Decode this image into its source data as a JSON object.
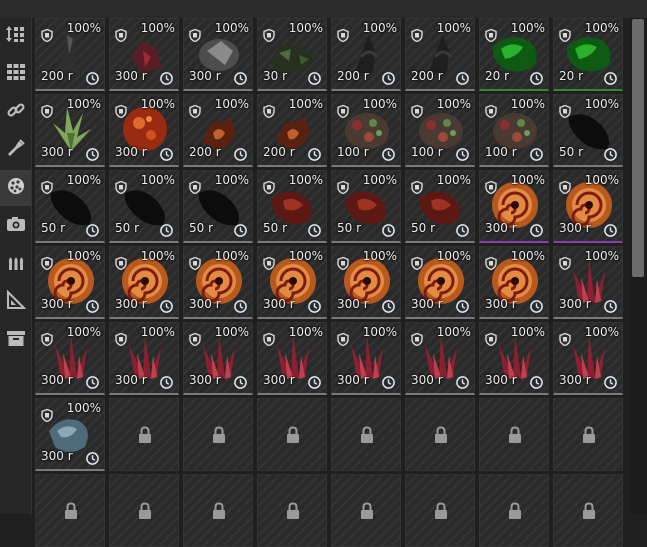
{
  "sidebar": {
    "items": [
      {
        "icon": "sort-grid-icon"
      },
      {
        "icon": "grid-icon"
      },
      {
        "icon": "link-icon"
      },
      {
        "icon": "flashlight-icon"
      },
      {
        "icon": "orb-icon",
        "active": true
      },
      {
        "icon": "camera-icon"
      },
      {
        "icon": "ammo-icon"
      },
      {
        "icon": "triangle-ruler-icon"
      },
      {
        "icon": "archive-box-icon"
      }
    ]
  },
  "grid": {
    "columns": 8,
    "items": [
      {
        "percent": "100%",
        "price": "200 r",
        "art": "grey-shard"
      },
      {
        "percent": "100%",
        "price": "300 r",
        "art": "red-crystal"
      },
      {
        "percent": "100%",
        "price": "300 r",
        "art": "grey-rock"
      },
      {
        "percent": "100%",
        "price": "30 r",
        "art": "green-rock"
      },
      {
        "percent": "100%",
        "price": "200 r",
        "art": "dark-vines"
      },
      {
        "percent": "100%",
        "price": "200 r",
        "art": "dark-vines"
      },
      {
        "percent": "100%",
        "price": "20 r",
        "art": "green-blob",
        "rarity": "green"
      },
      {
        "percent": "100%",
        "price": "20 r",
        "art": "green-blob",
        "rarity": "green"
      },
      {
        "percent": "100%",
        "price": "300 r",
        "art": "green-spike"
      },
      {
        "percent": "100%",
        "price": "300 r",
        "art": "red-sphere"
      },
      {
        "percent": "100%",
        "price": "200 r",
        "art": "red-coral"
      },
      {
        "percent": "100%",
        "price": "200 r",
        "art": "red-coral"
      },
      {
        "percent": "100%",
        "price": "100 r",
        "art": "mixed-clump"
      },
      {
        "percent": "100%",
        "price": "100 r",
        "art": "mixed-clump"
      },
      {
        "percent": "100%",
        "price": "100 r",
        "art": "mixed-clump"
      },
      {
        "percent": "100%",
        "price": "50 r",
        "art": "black-stone"
      },
      {
        "percent": "100%",
        "price": "50 r",
        "art": "black-stone"
      },
      {
        "percent": "100%",
        "price": "50 r",
        "art": "black-stone"
      },
      {
        "percent": "100%",
        "price": "50 r",
        "art": "black-stone"
      },
      {
        "percent": "100%",
        "price": "50 r",
        "art": "red-chunk"
      },
      {
        "percent": "100%",
        "price": "50 r",
        "art": "red-chunk"
      },
      {
        "percent": "100%",
        "price": "50 r",
        "art": "red-chunk"
      },
      {
        "percent": "100%",
        "price": "300 r",
        "art": "swirl",
        "rarity": "purple"
      },
      {
        "percent": "100%",
        "price": "300 r",
        "art": "swirl",
        "rarity": "purple"
      },
      {
        "percent": "100%",
        "price": "300 r",
        "art": "swirl"
      },
      {
        "percent": "100%",
        "price": "300 r",
        "art": "swirl"
      },
      {
        "percent": "100%",
        "price": "300 r",
        "art": "swirl"
      },
      {
        "percent": "100%",
        "price": "300 r",
        "art": "swirl"
      },
      {
        "percent": "100%",
        "price": "300 r",
        "art": "swirl"
      },
      {
        "percent": "100%",
        "price": "300 r",
        "art": "swirl"
      },
      {
        "percent": "100%",
        "price": "300 r",
        "art": "swirl"
      },
      {
        "percent": "100%",
        "price": "300 r",
        "art": "red-crystal-cluster"
      },
      {
        "percent": "100%",
        "price": "300 r",
        "art": "red-crystal-cluster"
      },
      {
        "percent": "100%",
        "price": "300 r",
        "art": "red-crystal-cluster"
      },
      {
        "percent": "100%",
        "price": "300 r",
        "art": "red-crystal-cluster"
      },
      {
        "percent": "100%",
        "price": "300 r",
        "art": "red-crystal-cluster"
      },
      {
        "percent": "100%",
        "price": "300 r",
        "art": "red-crystal-cluster"
      },
      {
        "percent": "100%",
        "price": "300 r",
        "art": "red-crystal-cluster"
      },
      {
        "percent": "100%",
        "price": "300 r",
        "art": "red-crystal-cluster"
      },
      {
        "percent": "100%",
        "price": "300 r",
        "art": "red-crystal-cluster"
      },
      {
        "percent": "100%",
        "price": "300 r",
        "art": "blue-grey-stone"
      },
      {
        "locked": true
      },
      {
        "locked": true
      },
      {
        "locked": true
      },
      {
        "locked": true
      },
      {
        "locked": true
      },
      {
        "locked": true
      },
      {
        "locked": true
      },
      {
        "locked": true
      },
      {
        "locked": true
      },
      {
        "locked": true
      },
      {
        "locked": true
      },
      {
        "locked": true
      },
      {
        "locked": true
      },
      {
        "locked": true
      },
      {
        "locked": true
      }
    ]
  },
  "colors": {
    "background": "#1f1f1f",
    "cell": "#2a2a2a",
    "text": "#eeeeee",
    "rarity_purple": "#8a3fb0",
    "rarity_green": "#2f8a33"
  }
}
